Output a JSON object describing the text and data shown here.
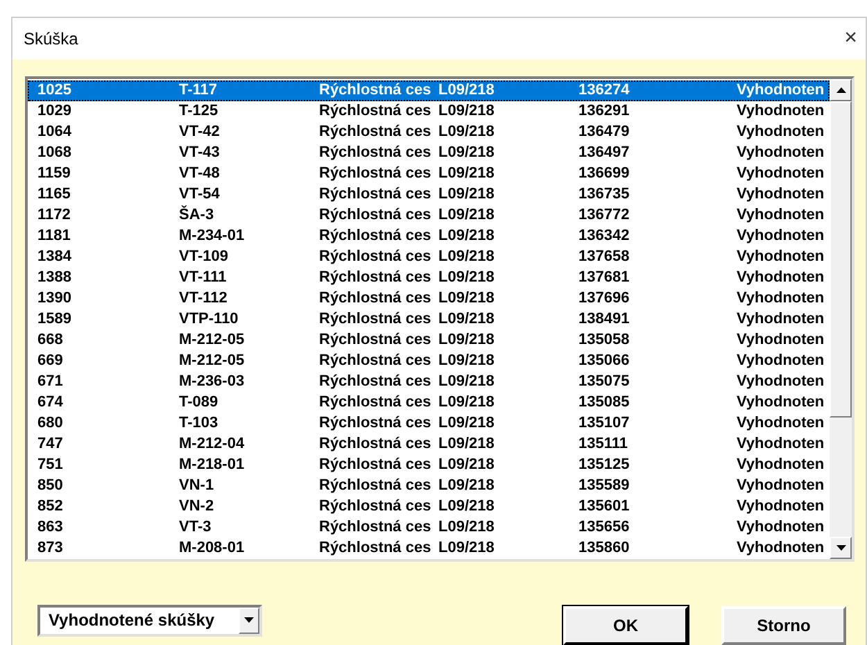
{
  "window": {
    "title": "Skúška",
    "close": "×"
  },
  "list": {
    "rows": [
      {
        "cells": [
          "1025",
          "T-117",
          "Rýchlostná ces",
          "L09/218",
          "136274",
          "Vyhodnoten"
        ],
        "selected": true
      },
      {
        "cells": [
          "1029",
          "T-125",
          "Rýchlostná ces",
          "L09/218",
          "136291",
          "Vyhodnoten"
        ],
        "selected": false
      },
      {
        "cells": [
          "1064",
          "VT-42",
          "Rýchlostná ces",
          "L09/218",
          "136479",
          "Vyhodnoten"
        ],
        "selected": false
      },
      {
        "cells": [
          "1068",
          "VT-43",
          "Rýchlostná ces",
          "L09/218",
          "136497",
          "Vyhodnoten"
        ],
        "selected": false
      },
      {
        "cells": [
          "1159",
          "VT-48",
          "Rýchlostná ces",
          "L09/218",
          "136699",
          "Vyhodnoten"
        ],
        "selected": false
      },
      {
        "cells": [
          "1165",
          "VT-54",
          "Rýchlostná ces",
          "L09/218",
          "136735",
          "Vyhodnoten"
        ],
        "selected": false
      },
      {
        "cells": [
          "1172",
          "ŠA-3",
          "Rýchlostná ces",
          "L09/218",
          "136772",
          "Vyhodnoten"
        ],
        "selected": false
      },
      {
        "cells": [
          "1181",
          "M-234-01",
          "Rýchlostná ces",
          "L09/218",
          "136342",
          "Vyhodnoten"
        ],
        "selected": false
      },
      {
        "cells": [
          "1384",
          "VT-109",
          "Rýchlostná ces",
          "L09/218",
          "137658",
          "Vyhodnoten"
        ],
        "selected": false
      },
      {
        "cells": [
          "1388",
          "VT-111",
          "Rýchlostná ces",
          "L09/218",
          "137681",
          "Vyhodnoten"
        ],
        "selected": false
      },
      {
        "cells": [
          "1390",
          "VT-112",
          "Rýchlostná ces",
          "L09/218",
          "137696",
          "Vyhodnoten"
        ],
        "selected": false
      },
      {
        "cells": [
          "1589",
          "VTP-110",
          "Rýchlostná ces",
          "L09/218",
          "138491",
          "Vyhodnoten"
        ],
        "selected": false
      },
      {
        "cells": [
          "668",
          "M-212-05",
          "Rýchlostná ces",
          "L09/218",
          "135058",
          "Vyhodnoten"
        ],
        "selected": false
      },
      {
        "cells": [
          "669",
          "M-212-05",
          "Rýchlostná ces",
          "L09/218",
          "135066",
          "Vyhodnoten"
        ],
        "selected": false
      },
      {
        "cells": [
          "671",
          "M-236-03",
          "Rýchlostná ces",
          "L09/218",
          "135075",
          "Vyhodnoten"
        ],
        "selected": false
      },
      {
        "cells": [
          "674",
          "T-089",
          "Rýchlostná ces",
          "L09/218",
          "135085",
          "Vyhodnoten"
        ],
        "selected": false
      },
      {
        "cells": [
          "680",
          "T-103",
          "Rýchlostná ces",
          "L09/218",
          "135107",
          "Vyhodnoten"
        ],
        "selected": false
      },
      {
        "cells": [
          "747",
          "M-212-04",
          "Rýchlostná ces",
          "L09/218",
          "135111",
          "Vyhodnoten"
        ],
        "selected": false
      },
      {
        "cells": [
          "751",
          "M-218-01",
          "Rýchlostná ces",
          "L09/218",
          "135125",
          "Vyhodnoten"
        ],
        "selected": false
      },
      {
        "cells": [
          "850",
          "VN-1",
          "Rýchlostná ces",
          "L09/218",
          "135589",
          "Vyhodnoten"
        ],
        "selected": false
      },
      {
        "cells": [
          "852",
          "VN-2",
          "Rýchlostná ces",
          "L09/218",
          "135601",
          "Vyhodnoten"
        ],
        "selected": false
      },
      {
        "cells": [
          "863",
          "VT-3",
          "Rýchlostná ces",
          "L09/218",
          "135656",
          "Vyhodnoten"
        ],
        "selected": false
      },
      {
        "cells": [
          "873",
          "M-208-01",
          "Rýchlostná ces",
          "L09/218",
          "135860",
          "Vyhodnoten"
        ],
        "selected": false
      }
    ]
  },
  "filter": {
    "value": "Vyhodnotené skúšky"
  },
  "buttons": [
    {
      "label": "OK",
      "default": true
    },
    {
      "label": "Storno",
      "default": false
    }
  ]
}
